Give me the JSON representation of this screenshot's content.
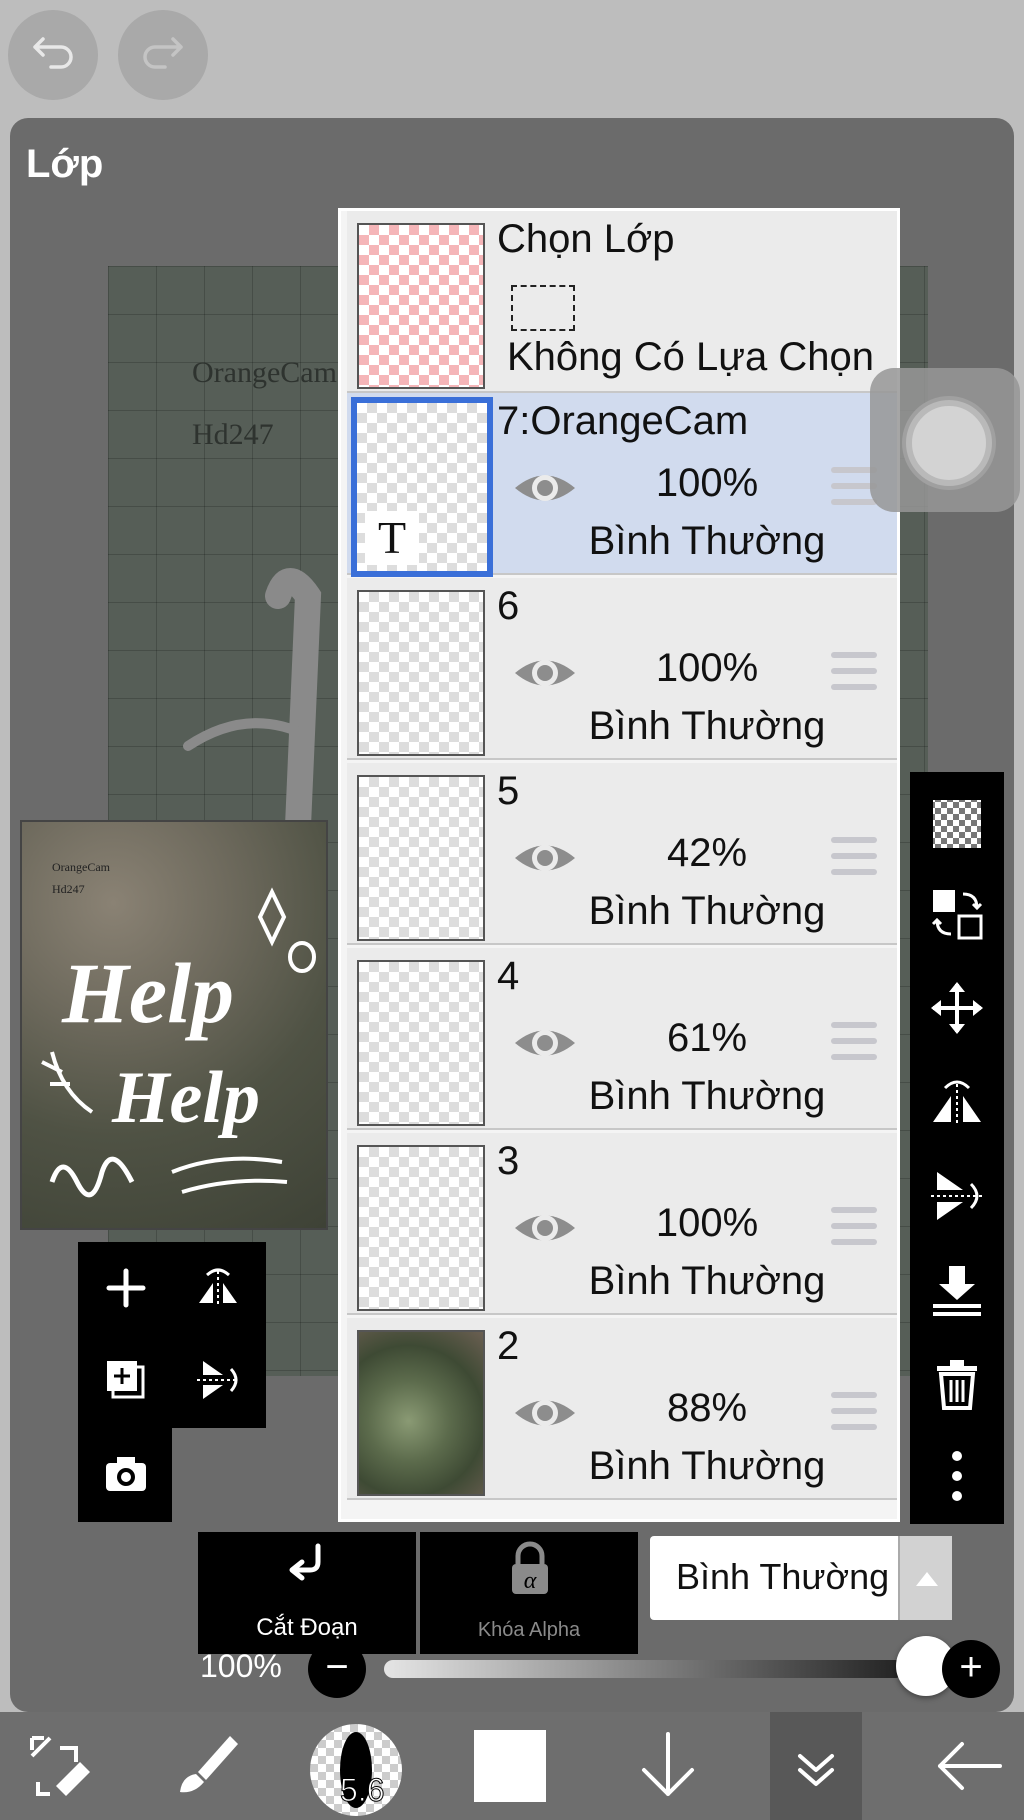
{
  "panel": {
    "title": "Lớp"
  },
  "canvas": {
    "text_line1": "OrangeCam",
    "text_line2": "Hd247"
  },
  "preview": {
    "mini_line1": "OrangeCam",
    "mini_line2": "Hd247",
    "art_word": "Help"
  },
  "selection_layer": {
    "title": "Chọn Lớp",
    "status": "Không Có Lựa Chọn"
  },
  "layers": [
    {
      "name": "7:OrangeCam",
      "opacity": "100%",
      "blend": "Bình Thường",
      "selected": true,
      "type": "text"
    },
    {
      "name": "6",
      "opacity": "100%",
      "blend": "Bình Thường",
      "selected": false
    },
    {
      "name": "5",
      "opacity": "42%",
      "blend": "Bình Thường",
      "selected": false
    },
    {
      "name": "4",
      "opacity": "61%",
      "blend": "Bình Thường",
      "selected": false
    },
    {
      "name": "3",
      "opacity": "100%",
      "blend": "Bình Thường",
      "selected": false
    },
    {
      "name": "2",
      "opacity": "88%",
      "blend": "Bình Thường",
      "selected": false,
      "type": "photo"
    }
  ],
  "text_layer_glyph": "T",
  "bottom_controls": {
    "clip_label": "Cắt Đoạn",
    "alpha_lock_label": "Khóa Alpha",
    "blend_mode": "Bình Thường"
  },
  "layer_opacity": {
    "label": "100%",
    "value": 1.0,
    "minus": "−",
    "plus": "+"
  },
  "brush": {
    "size": "5.6"
  },
  "colors": {
    "accent": "#3a6fd8",
    "selected_row": "#d1dbee",
    "panel_bg": "#6b6b6b",
    "toolbar": "#000000"
  },
  "icons": {
    "top": [
      "undo-icon",
      "redo-icon"
    ],
    "left_toolbar": [
      "add-layer-icon",
      "flip-horizontal-icon",
      "duplicate-layer-icon",
      "flip-vertical-icon",
      "camera-icon"
    ],
    "right_toolbar": [
      "transparency-icon",
      "layer-swap-icon",
      "move-icon",
      "flip-horizontal-icon",
      "flip-vertical-icon",
      "merge-down-icon",
      "trash-icon",
      "more-icon"
    ],
    "bottom_bar": [
      "transform-icon",
      "brush-icon",
      "brush-size-icon",
      "color-swatch-icon",
      "arrow-down-icon",
      "layers-icon",
      "back-arrow-icon"
    ]
  }
}
